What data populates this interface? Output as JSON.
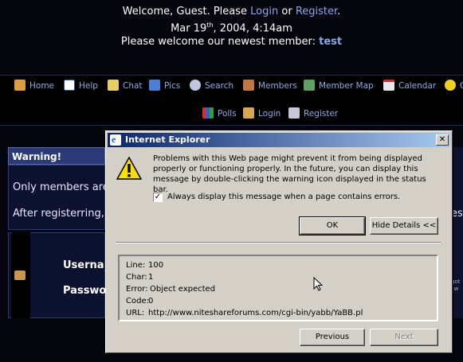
{
  "header": {
    "welcome_prefix": "Welcome, Guest. Please ",
    "login_link": "Login",
    "or_text": " or ",
    "register_link": "Register",
    "period": ".",
    "date_part1": "Mar 19",
    "date_sup": "th",
    "date_part2": ", 2004, 4:14am",
    "newest_prefix": "Please welcome our newest member: ",
    "newest_member": "test"
  },
  "nav": {
    "row1": [
      "Home",
      "Help",
      "Chat",
      "Pics",
      "Search",
      "Members",
      "Member Map",
      "Calendar",
      "Ga"
    ],
    "row2": [
      "Polls",
      "Login",
      "Register"
    ]
  },
  "background": {
    "warning_heading": "Warning!",
    "line1": "Only members are",
    "line2": "After registerring,",
    "username_label": "Userna",
    "password_label": "Passwo",
    "right_fragment": "es",
    "right_small": "got\nsw"
  },
  "dialog": {
    "title": "Internet Explorer",
    "close_glyph": "✕",
    "message": "Problems with this Web page might prevent it from being displayed properly or functioning properly. In the future, you can display this message by double-clicking the warning icon displayed in the status bar.",
    "checkbox_label": "Always display this message when a page contains errors.",
    "checkbox_checked": true,
    "ok_label": "OK",
    "hide_details_label": "Hide Details <<",
    "details": {
      "line_label": "Line:",
      "line_value": "100",
      "char_label": "Char:",
      "char_value": "1",
      "error_label": "Error:",
      "error_value": "Object expected",
      "code_label": "Code:",
      "code_value": "0",
      "url_label": "URL:",
      "url_value": "http://www.niteshareforums.com/cgi-bin/yabb/YaBB.pl"
    },
    "previous_label": "Previous",
    "next_label": "Next"
  },
  "colors": {
    "link": "#8aa6e6",
    "nav_text": "#8fa8e6",
    "titlebar_start": "#0a246a",
    "titlebar_end": "#a6caf0",
    "dialog_face": "#d4d0c8"
  }
}
